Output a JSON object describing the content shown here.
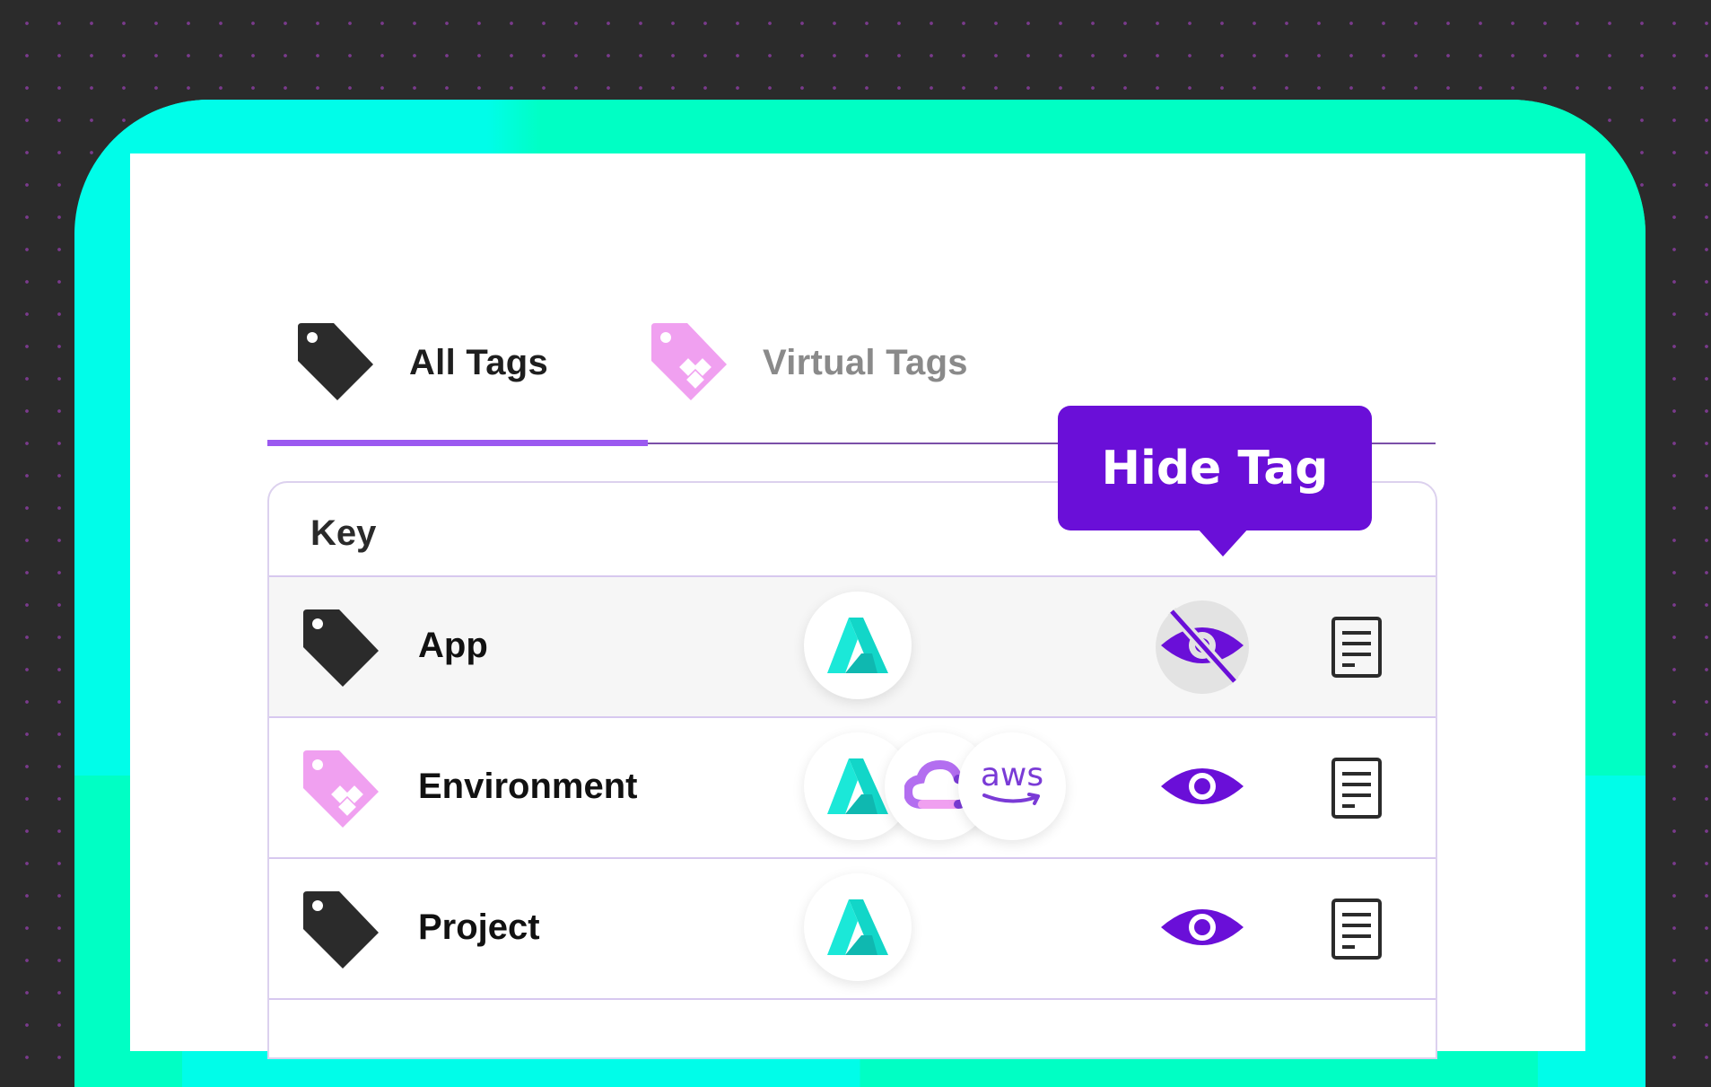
{
  "tabs": [
    {
      "label": "All Tags",
      "icon": "tag-icon",
      "active": true
    },
    {
      "label": "Virtual Tags",
      "icon": "virtual-tag-icon",
      "active": false
    }
  ],
  "table": {
    "header": {
      "key_label": "Key"
    },
    "rows": [
      {
        "name": "App",
        "tag_type": "tag-icon",
        "providers": [
          "azure-icon"
        ],
        "visibility": "hidden",
        "highlighted": true
      },
      {
        "name": "Environment",
        "tag_type": "virtual-tag-icon",
        "providers": [
          "azure-icon",
          "gcp-cloud-icon",
          "aws"
        ],
        "visibility": "visible",
        "highlighted": false
      },
      {
        "name": "Project",
        "tag_type": "tag-icon",
        "providers": [
          "azure-icon"
        ],
        "visibility": "visible",
        "highlighted": false
      }
    ]
  },
  "tooltip": {
    "text": "Hide Tag"
  },
  "colors": {
    "accent": "#6a0fd8",
    "tab_underline": "#9b59f0",
    "frame_cyan": "#00fde9",
    "frame_green": "#00ffc4",
    "virtual_tag_pink": "#f0a0f0",
    "tag_dark": "#2b2b2b"
  }
}
